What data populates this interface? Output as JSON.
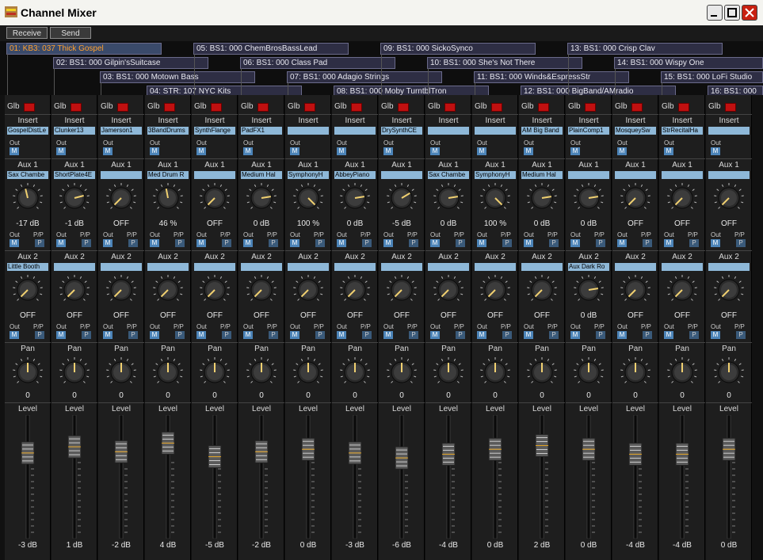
{
  "window": {
    "title": "Channel Mixer"
  },
  "toolbar": {
    "receive": "Receive",
    "send": "Send"
  },
  "labels": {
    "glb": "Glb",
    "insert": "Insert",
    "out": "Out",
    "aux1": "Aux 1",
    "aux2": "Aux 2",
    "pp": "P/P",
    "pan": "Pan",
    "level": "Level",
    "m": "M",
    "p": "P"
  },
  "colors": {
    "accent": "#ffa030",
    "slot": "#8eb8d8",
    "led": "#c01010"
  },
  "channels": [
    {
      "tag": "01: KB3: 037  Thick Gospel",
      "insert": "GospelDistLe",
      "aux1_slot": "Sax Chambe",
      "aux1": "-17 dB",
      "aux1_level": 0.45,
      "aux2_slot": "Little Booth",
      "aux2": "OFF",
      "aux2_level": 0,
      "pan": "0",
      "pan_level": 0.5,
      "level": "-3 dB",
      "level_pos": 0.23
    },
    {
      "tag": "02: BS1: 000  Gilpin'sSuitcase",
      "insert": "Clunker13",
      "aux1_slot": "ShortPlate4E",
      "aux1": "-1 dB",
      "aux1_level": 0.78,
      "aux2_slot": "",
      "aux2": "OFF",
      "aux2_level": 0,
      "pan": "0",
      "pan_level": 0.5,
      "level": "1 dB",
      "level_pos": 0.18
    },
    {
      "tag": "03: BS1: 000  Motown Bass",
      "insert": "Jamerson1",
      "aux1_slot": "",
      "aux1": "OFF",
      "aux1_level": 0,
      "aux2_slot": "",
      "aux2": "OFF",
      "aux2_level": 0,
      "pan": "0",
      "pan_level": 0.5,
      "level": "-2 dB",
      "level_pos": 0.22
    },
    {
      "tag": "04: STR: 107  NYC Kits",
      "insert": "3BandDrums",
      "aux1_slot": "Med Drum R",
      "aux1": "46 %",
      "aux1_level": 0.46,
      "aux2_slot": "",
      "aux2": "OFF",
      "aux2_level": 0,
      "pan": "0",
      "pan_level": 0.5,
      "level": "4 dB",
      "level_pos": 0.15
    },
    {
      "tag": "05: BS1: 000  ChemBrosBassLead",
      "insert": "SynthFlange",
      "aux1_slot": "",
      "aux1": "OFF",
      "aux1_level": 0,
      "aux2_slot": "",
      "aux2": "OFF",
      "aux2_level": 0,
      "pan": "0",
      "pan_level": 0.5,
      "level": "-5 dB",
      "level_pos": 0.26
    },
    {
      "tag": "06: BS1: 000  Class Pad",
      "insert": "PadFX1",
      "aux1_slot": "Medium Hal",
      "aux1": "0 dB",
      "aux1_level": 0.8,
      "aux2_slot": "",
      "aux2": "OFF",
      "aux2_level": 0,
      "pan": "0",
      "pan_level": 0.5,
      "level": "-2 dB",
      "level_pos": 0.22
    },
    {
      "tag": "07: BS1: 000  Adagio Strings",
      "insert": "",
      "aux1_slot": "SymphonyH",
      "aux1": "100 %",
      "aux1_level": 1.0,
      "aux2_slot": "",
      "aux2": "OFF",
      "aux2_level": 0,
      "pan": "0",
      "pan_level": 0.5,
      "level": "0 dB",
      "level_pos": 0.2
    },
    {
      "tag": "08: BS1: 000  Moby TurntblTron",
      "insert": "",
      "aux1_slot": "AbbeyPiano",
      "aux1": "0 dB",
      "aux1_level": 0.8,
      "aux2_slot": "",
      "aux2": "OFF",
      "aux2_level": 0,
      "pan": "0",
      "pan_level": 0.5,
      "level": "-3 dB",
      "level_pos": 0.23
    },
    {
      "tag": "09: BS1: 000  SickoSynco",
      "insert": "DrySynthCE",
      "aux1_slot": "",
      "aux1": "-5 dB",
      "aux1_level": 0.72,
      "aux2_slot": "",
      "aux2": "OFF",
      "aux2_level": 0,
      "pan": "0",
      "pan_level": 0.5,
      "level": "-6 dB",
      "level_pos": 0.27
    },
    {
      "tag": "10: BS1: 000  She's Not There",
      "insert": "",
      "aux1_slot": "Sax Chambe",
      "aux1": "0 dB",
      "aux1_level": 0.8,
      "aux2_slot": "",
      "aux2": "OFF",
      "aux2_level": 0,
      "pan": "0",
      "pan_level": 0.5,
      "level": "-4 dB",
      "level_pos": 0.24
    },
    {
      "tag": "11: BS1: 000  Winds&EspressStr",
      "insert": "",
      "aux1_slot": "SymphonyH",
      "aux1": "100 %",
      "aux1_level": 1.0,
      "aux2_slot": "",
      "aux2": "OFF",
      "aux2_level": 0,
      "pan": "0",
      "pan_level": 0.5,
      "level": "0 dB",
      "level_pos": 0.2
    },
    {
      "tag": "12: BS1: 000  BigBand/AMradio",
      "insert": "AM Big Band",
      "aux1_slot": "Medium Hal",
      "aux1": "0 dB",
      "aux1_level": 0.8,
      "aux2_slot": "",
      "aux2": "OFF",
      "aux2_level": 0,
      "pan": "0",
      "pan_level": 0.5,
      "level": "2 dB",
      "level_pos": 0.17
    },
    {
      "tag": "13: BS1: 000  Crisp Clav",
      "insert": "PlainComp1",
      "aux1_slot": "",
      "aux1": "0 dB",
      "aux1_level": 0.8,
      "aux2_slot": "Aux Dark Ro",
      "aux2": "0 dB",
      "aux2_level": 0.8,
      "pan": "0",
      "pan_level": 0.5,
      "level": "0 dB",
      "level_pos": 0.2
    },
    {
      "tag": "14: BS1: 000  Wispy One",
      "insert": "MosqueySw",
      "aux1_slot": "",
      "aux1": "OFF",
      "aux1_level": 0,
      "aux2_slot": "",
      "aux2": "OFF",
      "aux2_level": 0,
      "pan": "0",
      "pan_level": 0.5,
      "level": "-4 dB",
      "level_pos": 0.24
    },
    {
      "tag": "15: BS1: 000  LoFi Studio",
      "insert": "StrRecitalHa",
      "aux1_slot": "",
      "aux1": "OFF",
      "aux1_level": 0,
      "aux2_slot": "",
      "aux2": "OFF",
      "aux2_level": 0,
      "pan": "0",
      "pan_level": 0.5,
      "level": "-4 dB",
      "level_pos": 0.24
    },
    {
      "tag": "16: BS1: 000",
      "insert": "",
      "aux1_slot": "",
      "aux1": "OFF",
      "aux1_level": 0,
      "aux2_slot": "",
      "aux2": "OFF",
      "aux2_level": 0,
      "pan": "0",
      "pan_level": 0.5,
      "level": "0 dB",
      "level_pos": 0.2
    }
  ]
}
